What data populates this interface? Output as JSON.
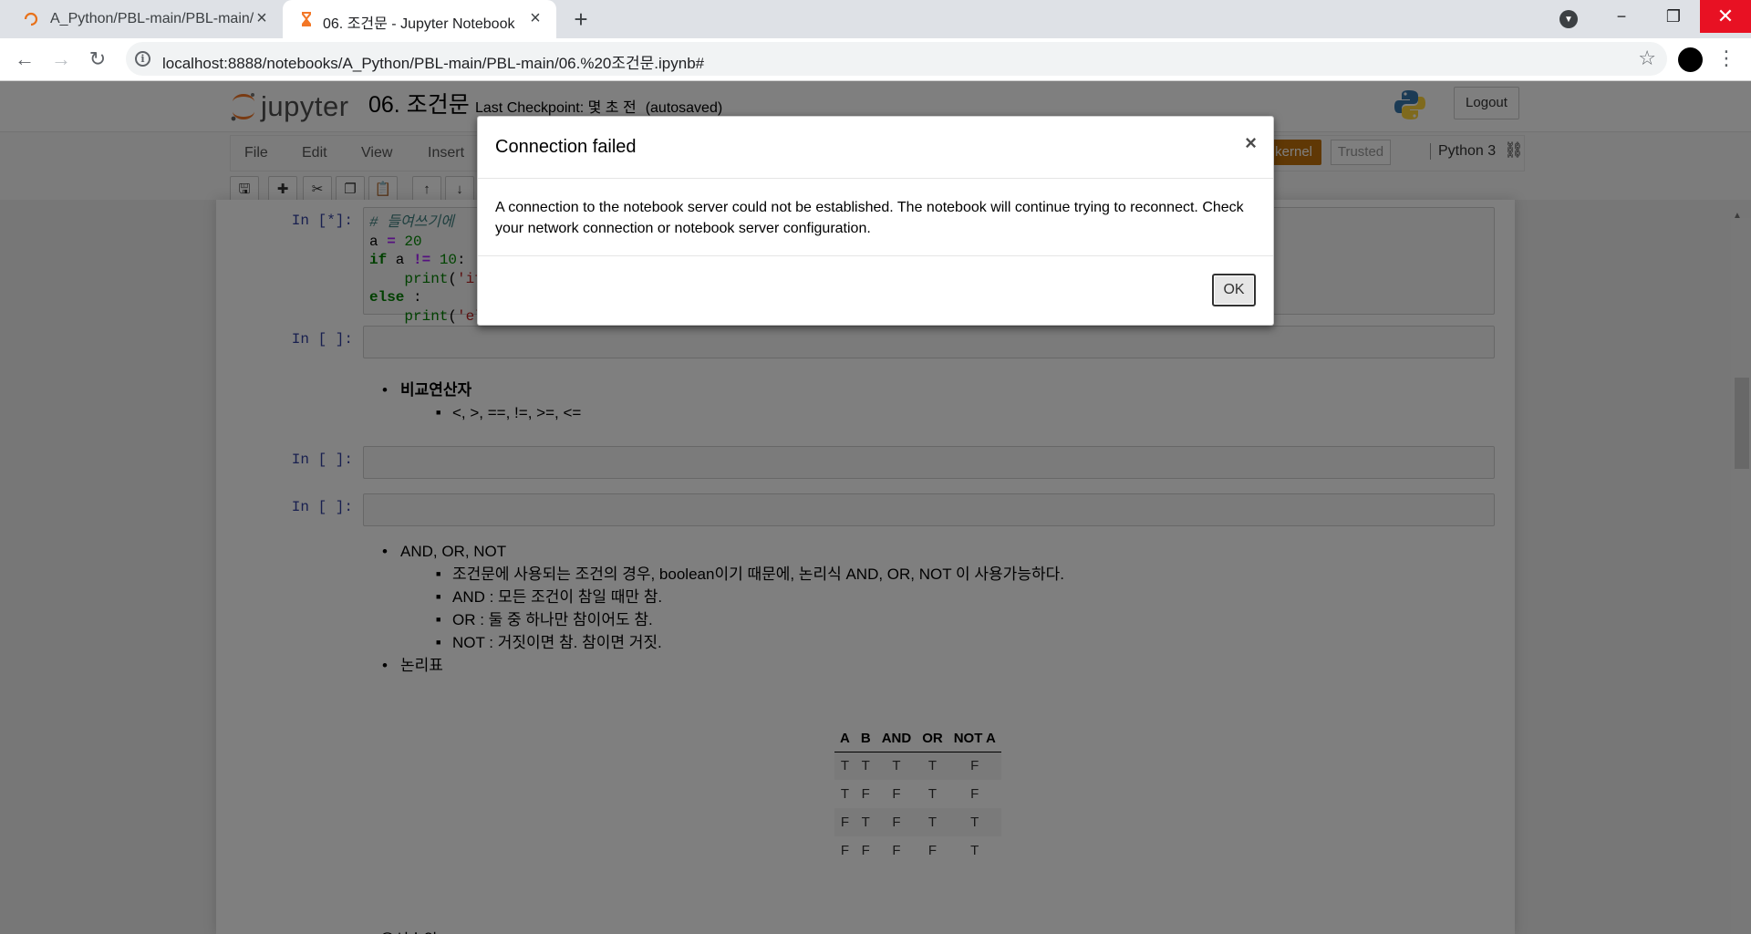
{
  "browser": {
    "tabs": [
      {
        "title": "A_Python/PBL-main/PBL-main/",
        "active": false
      },
      {
        "title": "06. 조건문 - Jupyter Notebook",
        "active": true
      }
    ],
    "new_tab_icon": "plus-icon",
    "url": "localhost:8888/notebooks/A_Python/PBL-main/PBL-main/06.%20조건문.ipynb#",
    "window_controls": {
      "minimize": "−",
      "maximize": "❐",
      "close": "✕"
    }
  },
  "jupyter": {
    "logo_text": "jupyter",
    "notebook_title": "06. 조건문",
    "checkpoint": "Last Checkpoint: 몇 초 전",
    "autosave": "(autosaved)",
    "logout_label": "Logout",
    "menu": [
      "File",
      "Edit",
      "View",
      "Insert"
    ],
    "kernel_badge": "n kernel",
    "trusted_label": "Trusted",
    "kernel_name": "Python 3"
  },
  "cells": {
    "cell1_prompt": "In [*]:",
    "cell1_code": [
      "# 들여쓰기에",
      "a = 20",
      "if a != 10:",
      "    print('if",
      "else :",
      "    print('else문 실행')"
    ],
    "cell2_prompt": "In [ ]:",
    "md1_title": "비교연산자",
    "md1_item": "<, >, ==, !=, >=, <=",
    "cell3_prompt": "In [ ]:",
    "cell4_prompt": "In [ ]:",
    "md2_title": "AND, OR, NOT",
    "md2_items": [
      "조건문에 사용되는 조건의 경우, boolean이기 때문에, 논리식 AND, OR, NOT 이 사용가능하다.",
      "AND : 모든 조건이 참일 때만 참.",
      "OR : 둘 중 하나만 참이어도 참.",
      "NOT : 거짓이면 참. 참이면 거짓."
    ],
    "md3_title": "논리표",
    "truth_table": {
      "headers": [
        "A",
        "B",
        "AND",
        "OR",
        "NOT A"
      ],
      "rows": [
        [
          "T",
          "T",
          "T",
          "T",
          "F"
        ],
        [
          "T",
          "F",
          "F",
          "T",
          "F"
        ],
        [
          "F",
          "T",
          "F",
          "T",
          "T"
        ],
        [
          "F",
          "F",
          "F",
          "F",
          "T"
        ]
      ]
    },
    "cut_text": "우선순위"
  },
  "modal": {
    "title": "Connection failed",
    "close": "×",
    "body": "A connection to the notebook server could not be established. The notebook will continue trying to reconnect. Check your network connection or notebook server configuration.",
    "ok_label": "OK"
  }
}
